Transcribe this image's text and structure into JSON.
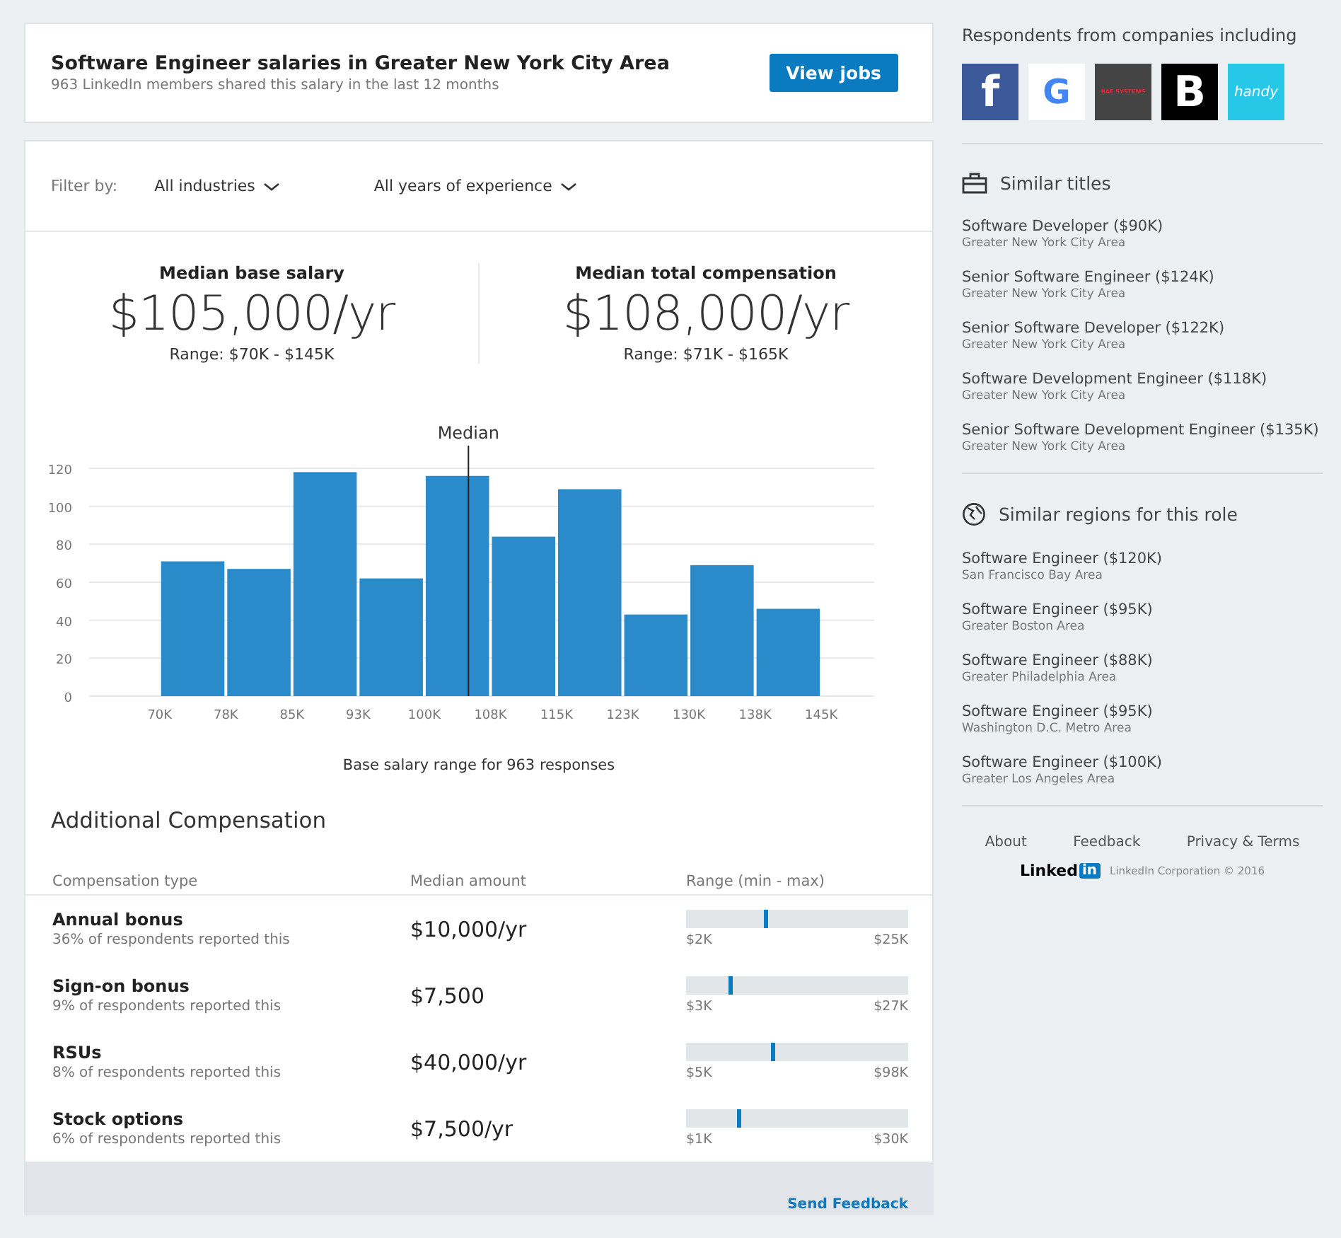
{
  "header": {
    "title": "Software Engineer salaries in Greater New York City Area",
    "subtitle": "963 LinkedIn members shared this salary in the last 12 months",
    "button": "View jobs"
  },
  "filters": {
    "label": "Filter by:",
    "dropdowns": [
      "All industries",
      "All years of experience"
    ]
  },
  "medians": [
    {
      "label": "Median base salary",
      "value": "$105,000/yr",
      "range": "Range: $70K - $145K"
    },
    {
      "label": "Median total compensation",
      "value": "$108,000/yr",
      "range": "Range: $71K - $165K"
    }
  ],
  "chart_data": {
    "type": "bar",
    "xlabel": "Base salary range for 963 responses",
    "grid": true,
    "x": [
      73.75,
      81.25,
      88.75,
      96.25,
      103.75,
      111.25,
      118.75,
      126.25,
      133.75,
      141.25
    ],
    "values": [
      71,
      67,
      118,
      62,
      116,
      84,
      109,
      43,
      69,
      46
    ],
    "xlim": [
      62,
      151
    ],
    "ylim": [
      0,
      120
    ],
    "yticks": [
      0,
      20,
      40,
      60,
      80,
      100,
      120
    ],
    "xticks": [
      {
        "value": 70,
        "label": "70K"
      },
      {
        "value": 77.5,
        "label": "78K"
      },
      {
        "value": 85,
        "label": "85K"
      },
      {
        "value": 92.5,
        "label": "93K"
      },
      {
        "value": 100,
        "label": "100K"
      },
      {
        "value": 107.5,
        "label": "108K"
      },
      {
        "value": 115,
        "label": "115K"
      },
      {
        "value": 122.5,
        "label": "123K"
      },
      {
        "value": 130,
        "label": "130K"
      },
      {
        "value": 137.5,
        "label": "138K"
      },
      {
        "value": 145,
        "label": "145K"
      }
    ],
    "ref_lines": [
      {
        "axis": "x",
        "value": 105,
        "label": "Median"
      }
    ]
  },
  "additional": {
    "title": "Additional Compensation",
    "columns": [
      "Compensation type",
      "Median amount",
      "Range (min - max)"
    ],
    "rows": [
      {
        "type": "Annual bonus",
        "note": "36% of respondents reported this",
        "amount": "$10,000/yr",
        "level": 0.35,
        "min": "$2K",
        "max": "$25K"
      },
      {
        "type": "Sign-on bonus",
        "note": "9% of respondents reported this",
        "amount": "$7,500",
        "level": 0.19,
        "min": "$3K",
        "max": "$27K"
      },
      {
        "type": "RSUs",
        "note": "8% of respondents reported this",
        "amount": "$40,000/yr",
        "level": 0.38,
        "min": "$5K",
        "max": "$98K"
      },
      {
        "type": "Stock options",
        "note": "6% of respondents reported this",
        "amount": "$7,500/yr",
        "level": 0.23,
        "min": "$1K",
        "max": "$30K"
      }
    ]
  },
  "feedback_link": "Send Feedback",
  "sidebar": {
    "companies_title": "Respondents from companies including",
    "companies": [
      {
        "mark": "f",
        "color": "#3b5998"
      },
      {
        "mark": "G",
        "color": "#ffffff"
      },
      {
        "mark": "BAE SYSTEMS",
        "color": "#444444"
      },
      {
        "mark": "B",
        "color": "#000000"
      },
      {
        "mark": "handy",
        "color": "#27c7e8"
      }
    ],
    "similar_titles": {
      "title": "Similar titles",
      "items": [
        {
          "name": "Software Developer ($90K)",
          "area": "Greater New York City Area"
        },
        {
          "name": "Senior Software Engineer ($124K)",
          "area": "Greater New York City Area"
        },
        {
          "name": "Senior Software Developer ($122K)",
          "area": "Greater New York City Area"
        },
        {
          "name": "Software Development Engineer ($118K)",
          "area": "Greater New York City Area"
        },
        {
          "name": "Senior Software Development Engineer ($135K)",
          "area": "Greater New York City Area"
        }
      ]
    },
    "similar_regions": {
      "title": "Similar regions for this role",
      "items": [
        {
          "name": "Software Engineer ($120K)",
          "area": "San Francisco Bay Area"
        },
        {
          "name": "Software Engineer ($95K)",
          "area": "Greater Boston Area"
        },
        {
          "name": "Software Engineer ($88K)",
          "area": "Greater Philadelphia Area"
        },
        {
          "name": "Software Engineer ($95K)",
          "area": "Washington D.C. Metro Area"
        },
        {
          "name": "Software Engineer ($100K)",
          "area": "Greater Los Angeles Area"
        }
      ]
    },
    "footer_links": [
      "About",
      "Feedback",
      "Privacy & Terms"
    ],
    "logo": {
      "word": "Linked",
      "box": "in"
    },
    "copyright": "LinkedIn Corporation © 2016"
  }
}
